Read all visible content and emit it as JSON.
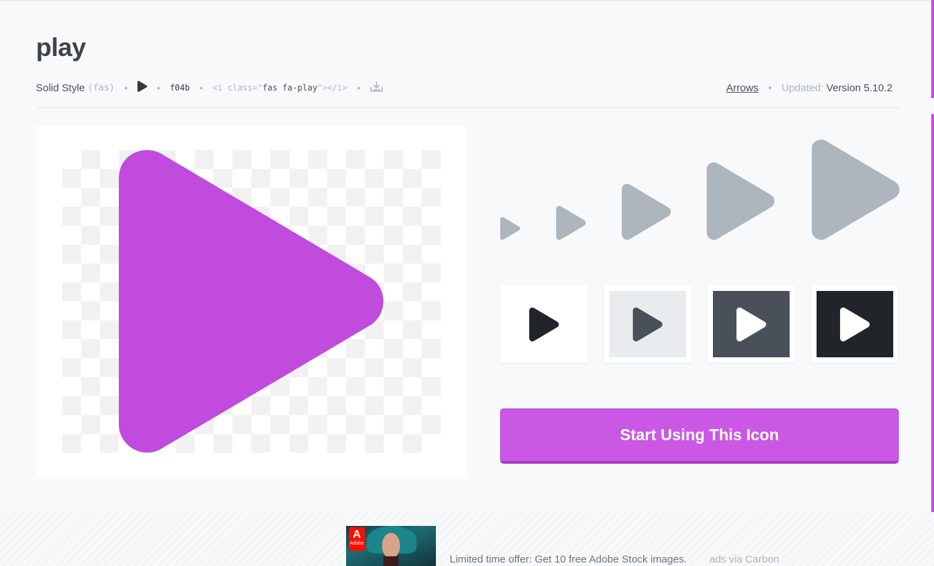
{
  "icon": {
    "name": "play",
    "style_label": "Solid Style",
    "style_prefix": "(fas)",
    "unicode": "f04b",
    "code_open": "<i class=\"",
    "code_class": "fas fa-play",
    "code_close": "\"></i>",
    "category": "Arrows",
    "updated_label": "Updated:",
    "version": "Version 5.10.2"
  },
  "colors": {
    "brand_purple": "#c04bdd",
    "cta_purple": "#cb57e5",
    "size_gray": "#adb5bd",
    "dark": "#212529"
  },
  "icons": {
    "glyph": "play-icon",
    "download": "download-icon"
  },
  "tiles": [
    {
      "bg": "#ffffff",
      "fg": "#212529"
    },
    {
      "bg": "#e9ecef",
      "fg": "#495057"
    },
    {
      "bg": "#495057",
      "fg": "#ffffff"
    },
    {
      "bg": "#212529",
      "fg": "#ffffff"
    }
  ],
  "cta": {
    "label": "Start Using This Icon"
  },
  "ad": {
    "brand_mark": "A",
    "brand_text": "Adobe",
    "text": "Limited time offer: Get 10 free Adobe Stock images.",
    "via": "ads via Carbon"
  }
}
